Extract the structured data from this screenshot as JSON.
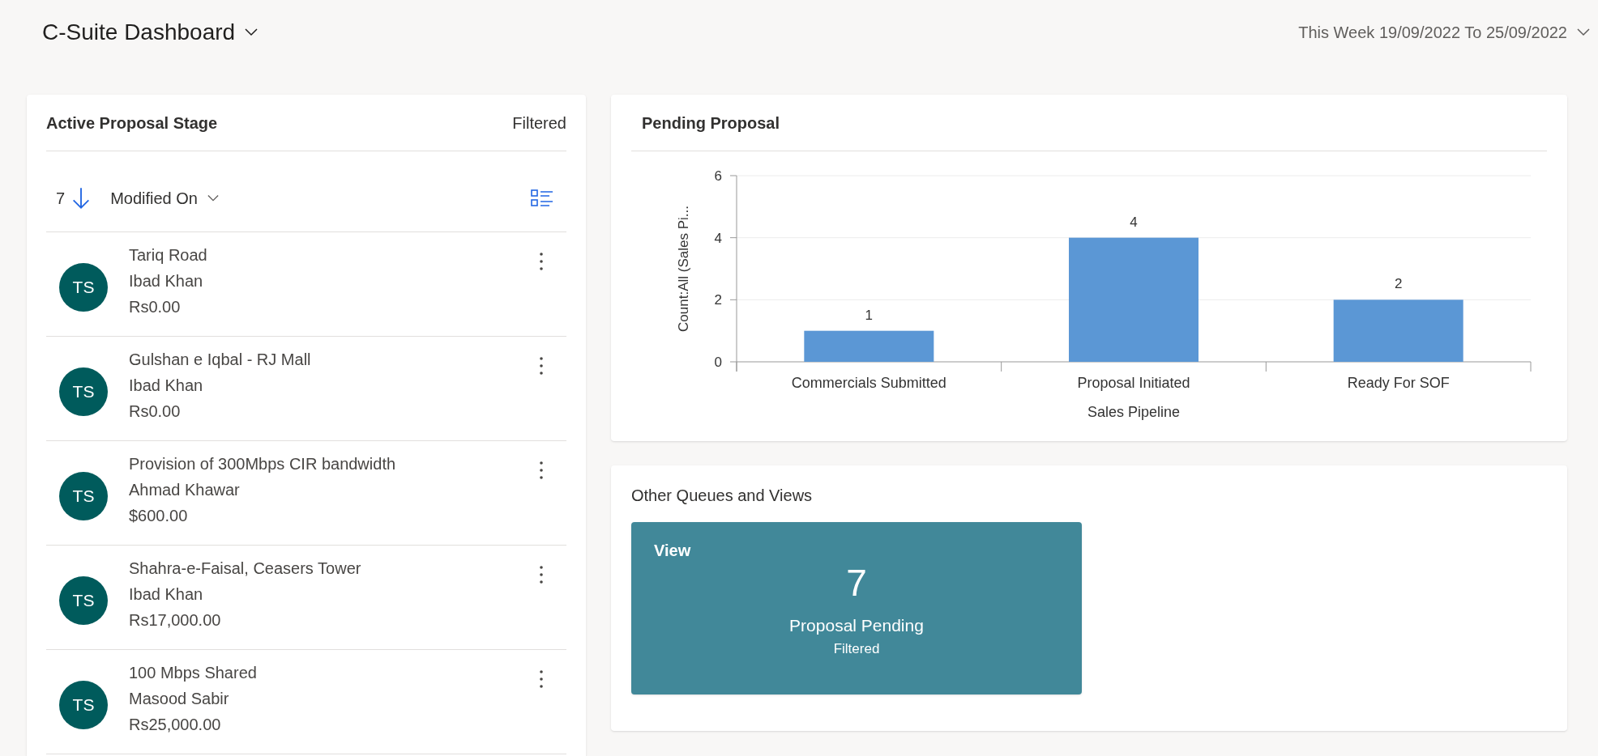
{
  "header": {
    "title": "C-Suite Dashboard",
    "date_range": "This Week 19/09/2022 To 25/09/2022"
  },
  "proposal_list": {
    "title": "Active Proposal Stage",
    "filter_label": "Filtered",
    "count": "7",
    "sort_field": "Modified On",
    "items": [
      {
        "avatar": "TS",
        "name": "Tariq Road",
        "owner": "Ibad Khan",
        "amount": "Rs0.00"
      },
      {
        "avatar": "TS",
        "name": "Gulshan e Iqbal - RJ Mall",
        "owner": "Ibad Khan",
        "amount": "Rs0.00"
      },
      {
        "avatar": "TS",
        "name": "Provision of 300Mbps CIR bandwidth",
        "owner": "Ahmad Khawar",
        "amount": "$600.00"
      },
      {
        "avatar": "TS",
        "name": "Shahra-e-Faisal, Ceasers Tower",
        "owner": "Ibad Khan",
        "amount": "Rs17,000.00"
      },
      {
        "avatar": "TS",
        "name": "100 Mbps Shared",
        "owner": "Masood Sabir",
        "amount": "Rs25,000.00"
      }
    ]
  },
  "pending_proposal": {
    "title": "Pending Proposal",
    "chart_data": {
      "type": "bar",
      "xlabel": "Sales Pipeline",
      "ylabel": "Count:All (Sales Pi...",
      "categories": [
        "Commercials Submitted",
        "Proposal Initiated",
        "Ready For SOF"
      ],
      "series": [
        {
          "color": "#5b97d5",
          "values": [
            1,
            4,
            2
          ]
        }
      ],
      "ylim": [
        0,
        6
      ],
      "yticks": [
        0,
        2,
        4,
        6
      ],
      "data_labels": true
    }
  },
  "queues": {
    "title": "Other Queues and Views",
    "tiles": [
      {
        "kind_label": "View",
        "count": "7",
        "name": "Proposal Pending",
        "filter_label": "Filtered"
      }
    ]
  }
}
